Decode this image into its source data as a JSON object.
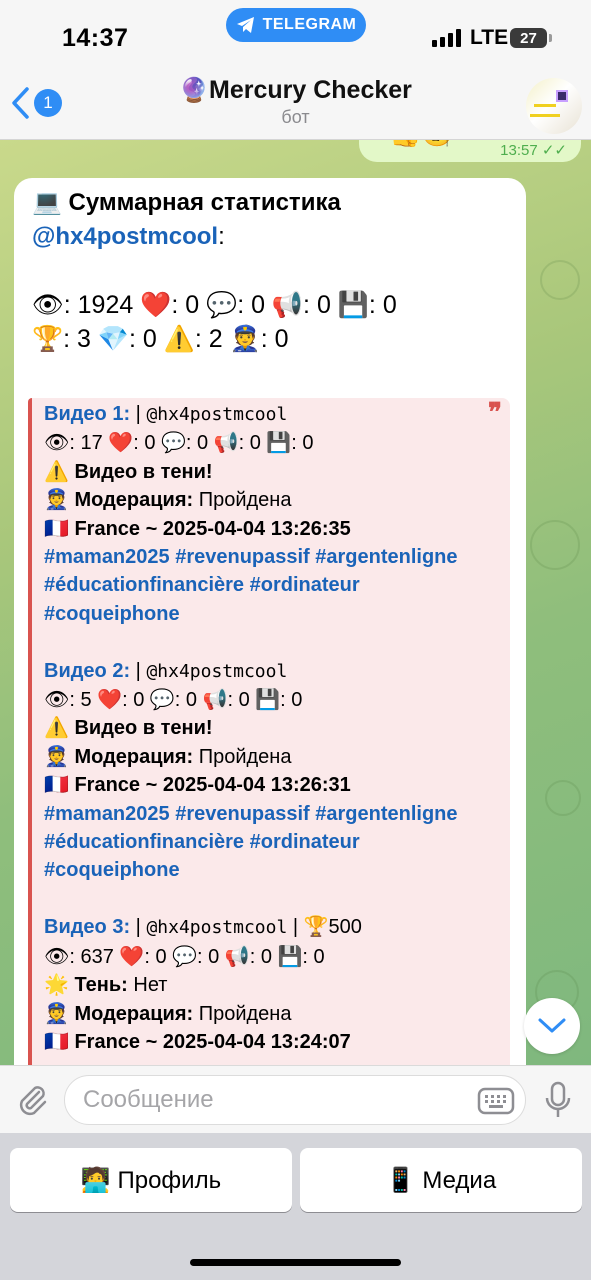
{
  "status_bar": {
    "time": "14:37",
    "app_pill": "TELEGRAM",
    "network": "LTE",
    "battery": "27"
  },
  "header": {
    "back_count": "1",
    "title_emoji": "🔮",
    "title": "Mercury Checker",
    "subtitle": "бот"
  },
  "outgoing": {
    "emoji": "👍🧐",
    "time": "13:57",
    "checks": "✓✓"
  },
  "message": {
    "title": "💻 Суммарная статистика",
    "mention": "@hx4postmcool",
    "mention_suffix": ":",
    "stats_line1": "👁: 1924 ❤️: 0 💬: 0 📢: 0 💾: 0",
    "stats_line2": "🏆: 3 💎: 0 ⚠️: 2 👮: 0",
    "quote_mark": "❞",
    "videos": [
      {
        "title": "Видео 1:",
        "sep": " | ",
        "user": "@hx4postmcool",
        "extra": "",
        "stats": "👁: 17 ❤️: 0 💬: 0 📢: 0 💾: 0",
        "status": "⚠️ Видео в тени!",
        "moderation_label": "👮 Модерация:",
        "moderation_value": " Пройдена",
        "location": "🇫🇷 France ~ 2025-04-04 13:26:35",
        "tags1": "#maman2025 #revenupassif #argentenligne",
        "tags2": "#éducationfinancière #ordinateur",
        "tags3": "#coqueiphone"
      },
      {
        "title": "Видео 2:",
        "sep": " | ",
        "user": "@hx4postmcool",
        "extra": "",
        "stats": "👁: 5 ❤️: 0 💬: 0 📢: 0 💾: 0",
        "status": "⚠️ Видео в тени!",
        "moderation_label": "👮 Модерация:",
        "moderation_value": " Пройдена",
        "location": "🇫🇷 France ~ 2025-04-04 13:26:31",
        "tags1": "#maman2025 #revenupassif #argentenligne",
        "tags2": "#éducationfinancière #ordinateur",
        "tags3": "#coqueiphone"
      },
      {
        "title": "Видео 3:",
        "sep": " | ",
        "user": "@hx4postmcool",
        "extra": " | 🏆500",
        "stats": "👁: 637 ❤️: 0 💬: 0 📢: 0 💾: 0",
        "status_label": "🌟 Тень:",
        "status_value": " Нет",
        "moderation_label": "👮 Модерация:",
        "moderation_value": " Пройдена",
        "location": "🇫🇷 France ~ 2025-04-04 13:24:07"
      }
    ]
  },
  "input": {
    "placeholder": "Сообщение"
  },
  "keyboard": {
    "left_button": "🧑‍💻 Профиль",
    "right_button": "📱 Медиа"
  }
}
